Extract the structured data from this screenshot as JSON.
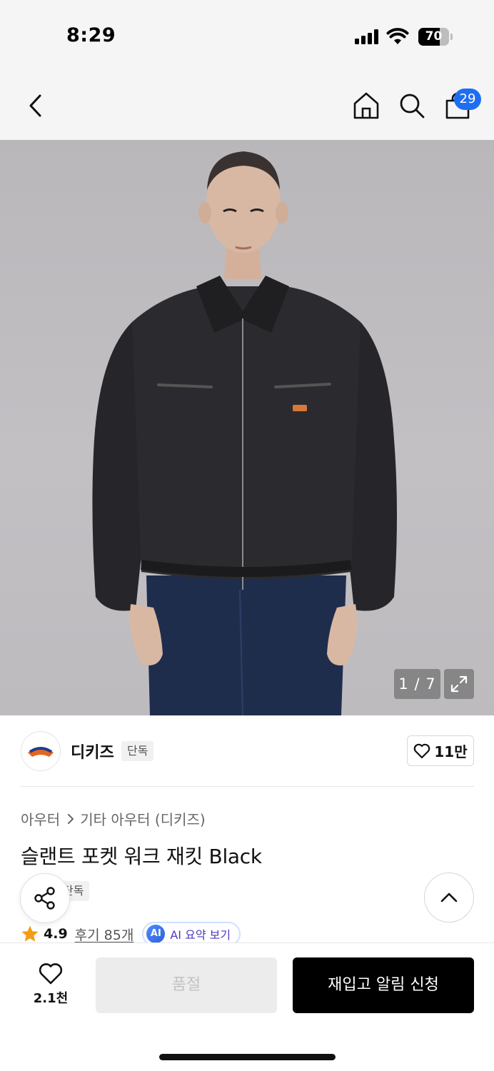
{
  "status_bar": {
    "time": "8:29",
    "battery_level": "70",
    "battery_fraction": 0.7,
    "icons": [
      "signal-icon",
      "wifi-icon",
      "battery-icon"
    ]
  },
  "nav": {
    "icons": [
      "back-arrow-icon",
      "home-icon",
      "search-icon",
      "shopping-bag-icon"
    ],
    "cart_badge": "29"
  },
  "gallery": {
    "counter": "1 / 7",
    "icons": [
      "expand-icon"
    ]
  },
  "brand": {
    "name": "디키즈",
    "tag": "단독",
    "logo_text": "Dickies",
    "likes": "11만"
  },
  "product": {
    "breadcrumb": [
      "아우터",
      "기타 아우터 (디키즈)"
    ],
    "title": "슬랜트 포켓 워크 재킷 Black",
    "tag": "단독",
    "rating": "4.9",
    "reviews": "후기 85개",
    "ai_badge": "AI",
    "ai_summary": "AI 요약 보기"
  },
  "actions": {
    "wish_count": "2.1천",
    "soldout_label": "품절",
    "restock_label": "재입고 알림 신청"
  },
  "colors": {
    "accent_blue": "#1e6ef2",
    "star": "#f39c12",
    "primary_button": "#000000",
    "disabled_button": "#ececec"
  }
}
